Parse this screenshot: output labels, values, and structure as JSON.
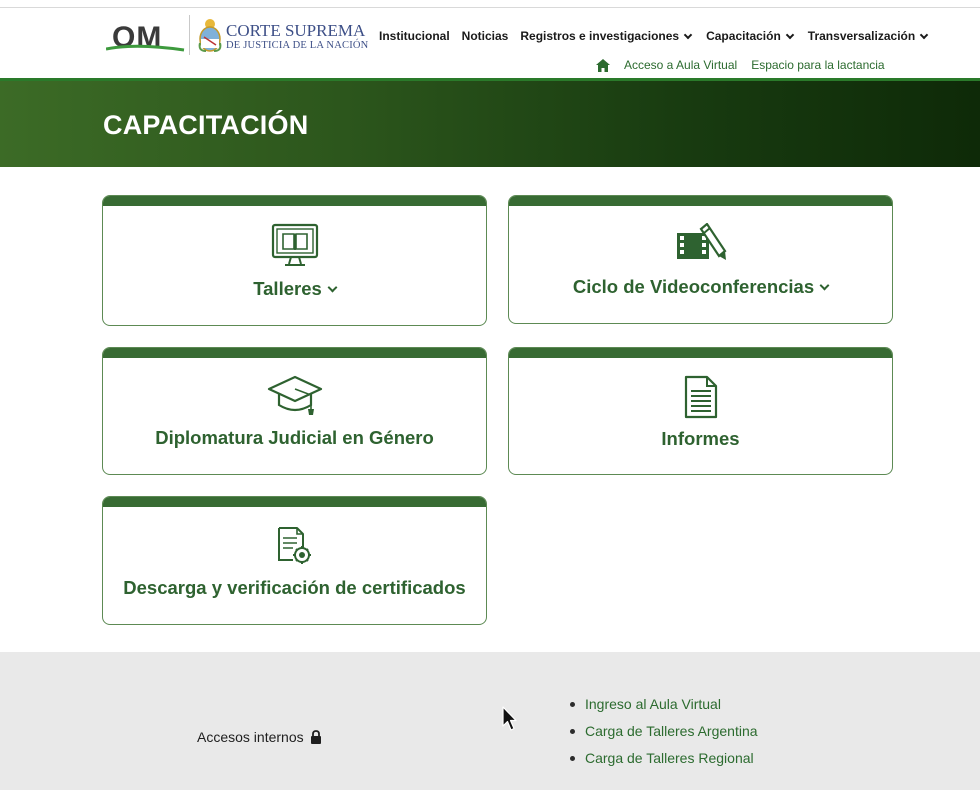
{
  "header": {
    "logo_om": "OM",
    "logo_cs_line1": "CORTE SUPREMA",
    "logo_cs_line2": "DE JUSTICIA DE LA NACIÓN",
    "nav": [
      {
        "label": "Institucional",
        "dropdown": false
      },
      {
        "label": "Noticias",
        "dropdown": false
      },
      {
        "label": "Registros e investigaciones",
        "dropdown": true
      },
      {
        "label": "Capacitación",
        "dropdown": true
      },
      {
        "label": "Transversalización",
        "dropdown": true
      }
    ],
    "subnav": {
      "home_icon": "home-icon",
      "aula": "Acceso a Aula Virtual",
      "lactancia": "Espacio para la lactancia"
    }
  },
  "banner": {
    "title": "CAPACITACIÓN"
  },
  "cards": [
    {
      "label": "Talleres",
      "icon": "monitor-book-icon",
      "dropdown": true
    },
    {
      "label": "Ciclo de Videoconferencias",
      "icon": "film-pencil-icon",
      "dropdown": true
    },
    {
      "label": "Diplomatura Judicial en Género",
      "icon": "graduation-cap-icon",
      "dropdown": false
    },
    {
      "label": "Informes",
      "icon": "document-icon",
      "dropdown": false
    },
    {
      "label": "Descarga y verificación de certificados",
      "icon": "certificate-icon",
      "dropdown": false
    }
  ],
  "footer": {
    "accesos": "Accesos internos",
    "lock_icon": "lock-icon",
    "links": [
      "Ingreso al Aula Virtual",
      "Carga de Talleres Argentina",
      "Carga de Talleres Regional"
    ]
  },
  "colors": {
    "brand_green": "#2e6230",
    "card_cap": "#386b33",
    "link_green": "#2c6b2f",
    "footer_bg": "#e9e9e9"
  }
}
